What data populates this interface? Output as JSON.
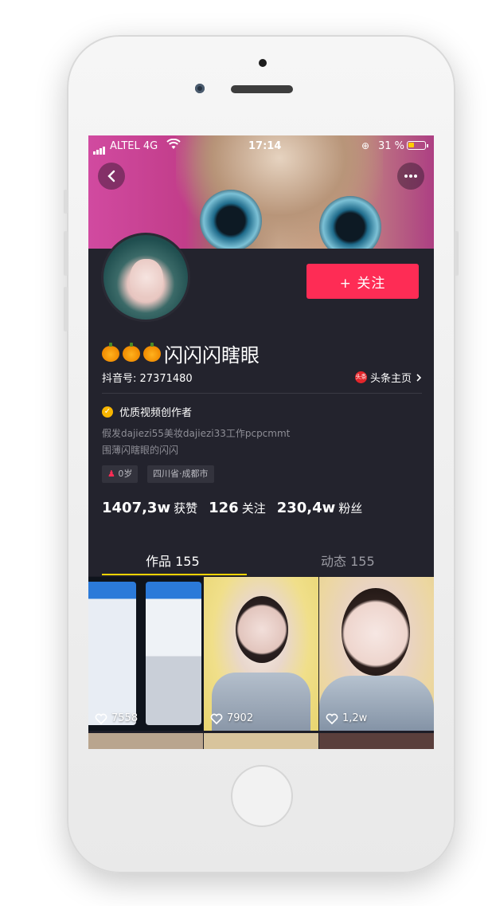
{
  "status_bar": {
    "carrier": "ALTEL 4G",
    "time": "17:14",
    "battery": "31 %"
  },
  "follow_button": "+ 关注",
  "user": {
    "name": "闪闪闪瞎眼",
    "id": "抖音号: 27371480"
  },
  "toutiao_link": "头条主页",
  "toutiao_logo_text": "头条",
  "verified_label": "优质视频创作者",
  "bio_lines": [
    "假发dajiezi55美妆dajiezi33工作pcpcmmt",
    "围薄闪瞎眼的闪闪"
  ],
  "tags": {
    "age": "0岁",
    "location": "四川省·成都市"
  },
  "stats": [
    {
      "value": "1407,3w",
      "label": "获赞"
    },
    {
      "value": "126",
      "label": "关注"
    },
    {
      "value": "230,4w",
      "label": "粉丝"
    }
  ],
  "tabs": [
    {
      "label": "作品 155",
      "active": true
    },
    {
      "label": "动态 155",
      "active": false
    }
  ],
  "videos": [
    {
      "likes": "7558"
    },
    {
      "likes": "7902"
    },
    {
      "likes": "1,2w"
    }
  ],
  "colors": {
    "accent": "#fe2c55",
    "tab_indicator": "#f7d300",
    "background": "#23232d",
    "verified": "#f7b500"
  },
  "icons": [
    "back-icon",
    "more-icon",
    "wifi-icon",
    "signal-icon",
    "battery-icon",
    "heart-icon",
    "verified-icon",
    "chevron-right-icon"
  ]
}
